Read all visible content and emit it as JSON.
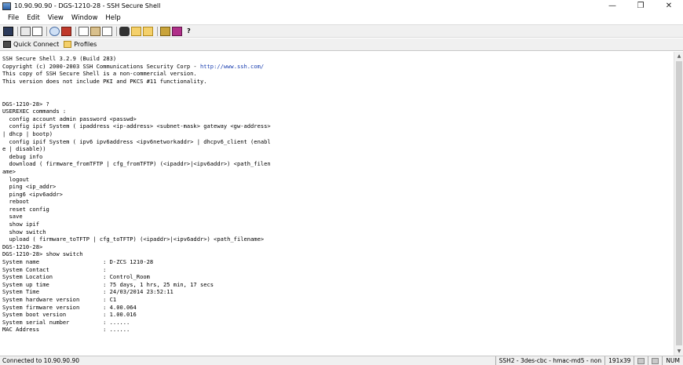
{
  "window": {
    "title": "10.90.90.90 - DGS-1210-28 - SSH Secure Shell",
    "minimize_glyph": "—",
    "maximize_glyph": "❐",
    "close_glyph": "✕"
  },
  "menu": {
    "items": [
      "File",
      "Edit",
      "View",
      "Window",
      "Help"
    ]
  },
  "toolbar": {
    "icons": [
      "save-icon",
      "print-icon",
      "print-preview-icon",
      "magnifier-icon",
      "disconnect-icon",
      "copy-icon",
      "paste-icon",
      "paste-special-icon",
      "find-icon",
      "file-transfer-icon",
      "settings-icon",
      "key-icon",
      "help-icon"
    ],
    "help_glyph": "?"
  },
  "toolbar2": {
    "quick_connect": "Quick Connect",
    "profiles": "Profiles"
  },
  "terminal": {
    "header_line1": "SSH Secure Shell 3.2.9 (Build 283)",
    "header_line2_prefix": "Copyright (c) 2000-2003 SSH Communications Security Corp - ",
    "header_line2_link": "http://www.ssh.com/",
    "body": "\nThis copy of SSH Secure Shell is a non-commercial version.\nThis version does not include PKI and PKCS #11 functionality.\n\n\nDGS-1210-28> ?\nUSEREXEC commands :\n  config account admin password <passwd>\n  config ipif System ( ipaddress <ip-address> <subnet-mask> gateway <gw-address>\n| dhcp | bootp)\n  config ipif System ( ipv6 ipv6address <ipv6networkaddr> | dhcpv6_client (enabl\ne | disable))\n  debug info\n  download ( firmware_fromTFTP | cfg_fromTFTP) (<ipaddr>|<ipv6addr>) <path_filen\name>\n  logout\n  ping <ip_addr>\n  ping6 <ipv6addr>\n  reboot\n  reset config\n  save\n  show ipif\n  show switch\n  upload ( firmware_toTFTP | cfg_toTFTP) (<ipaddr>|<ipv6addr>) <path_filename>\nDGS-1210-28>\nDGS-1210-28> show switch\nSystem name                   : D-ZCS 1210-28\nSystem Contact                :\nSystem Location               : Control_Room\nSystem up time                : 75 days, 1 hrs, 25 min, 17 secs\nSystem Time                   : 24/03/2014 23:52:11\nSystem hardware version       : C1\nSystem firmware version       : 4.00.064\nSystem boot version           : 1.00.016\nSystem serial number          : ......\nMAC Address                   : ......"
  },
  "status": {
    "left": "Connected to 10.90.90.90",
    "connection": "SSH2 - 3des-cbc - hmac-md5 - non",
    "size": "191x39",
    "num": "NUM"
  }
}
